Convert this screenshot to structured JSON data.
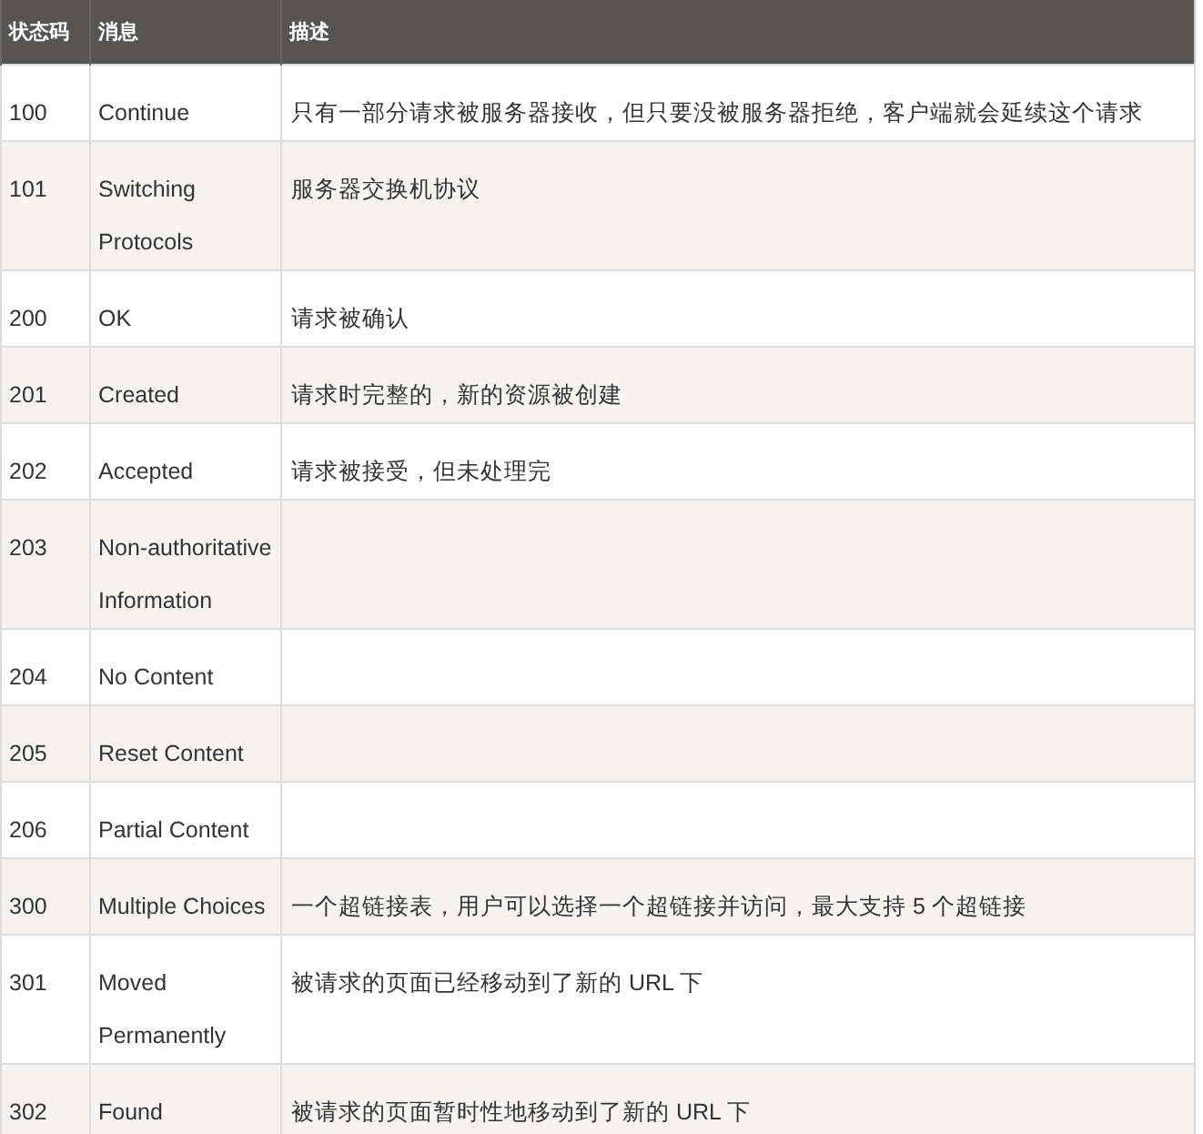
{
  "table": {
    "columns": [
      "状态码",
      "消息",
      "描述"
    ],
    "rows": [
      {
        "code": "100",
        "message": "Continue",
        "description": "只有一部分请求被服务器接收，但只要没被服务器拒绝，客户端就会延续这个请求"
      },
      {
        "code": "101",
        "message": "Switching Protocols",
        "description": "服务器交换机协议"
      },
      {
        "code": "200",
        "message": "OK",
        "description": "请求被确认"
      },
      {
        "code": "201",
        "message": "Created",
        "description": "请求时完整的，新的资源被创建"
      },
      {
        "code": "202",
        "message": "Accepted",
        "description": "请求被接受，但未处理完"
      },
      {
        "code": "203",
        "message": "Non-authoritative Information"
      },
      {
        "code": "204",
        "message": "No Content"
      },
      {
        "code": "205",
        "message": "Reset Content"
      },
      {
        "code": "206",
        "message": "Partial Content"
      },
      {
        "code": "300",
        "message": "Multiple Choices",
        "description": "一个超链接表，用户可以选择一个超链接并访问，最大支持 5 个超链接"
      },
      {
        "code": "301",
        "message": "Moved Permanently",
        "description": "被请求的页面已经移动到了新的 URL 下"
      },
      {
        "code": "302",
        "message": "Found",
        "description": "被请求的页面暂时性地移动到了新的 URL 下"
      }
    ]
  }
}
